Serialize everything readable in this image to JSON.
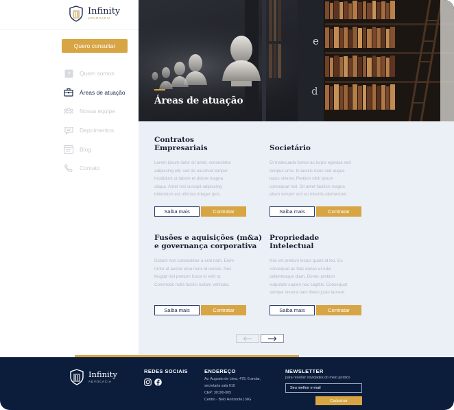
{
  "brand": {
    "name": "Infinity",
    "tagline": "ADVOCACIA"
  },
  "sidebar": {
    "cta_label": "Quero consultar",
    "items": [
      {
        "label": "Quem somos",
        "icon": "question-icon",
        "active": false
      },
      {
        "label": "Áreas de atuação",
        "icon": "briefcase-icon",
        "active": true
      },
      {
        "label": "Nossa equipe",
        "icon": "team-icon",
        "active": false
      },
      {
        "label": "Depoimentos",
        "icon": "chat-icon",
        "active": false
      },
      {
        "label": "Blog",
        "icon": "browser-icon",
        "active": false
      },
      {
        "label": "Contato",
        "icon": "phone-icon",
        "active": false
      }
    ]
  },
  "hero": {
    "title": "Áreas de atuação",
    "letters": [
      "e",
      "d"
    ]
  },
  "cards": [
    {
      "title_line1": "Contratos",
      "title_line2": "Empresariais",
      "text": [
        "Lorem ipsum dolor sit amet, consectetur",
        "adipiscing elit, sed do eiusmod tempor",
        "incididunt ut labore et dolore magna",
        "aliqua. Amet nisl suscipit adipiscing",
        "bibendum est ultricies integer quis."
      ],
      "more_label": "Saiba mais",
      "hire_label": "Contratar"
    },
    {
      "title_line1": "Societário",
      "title_line2": "",
      "text": [
        "Et malesuada fames ac turpis egestas sed",
        "tempus urna. In iaculis nunc sed augue",
        "lacus viverra. Pretium nibh ipsum",
        "consequat nisl. Sit amet facilisis magna",
        "etiam tempor orci eu lobortis elementum."
      ],
      "more_label": "Saiba mais",
      "hire_label": "Contratar"
    },
    {
      "title_line1": "Fusões e aquisições (m&a)",
      "title_line2": "e governança corporativa",
      "text": [
        "Dictum non consectetur a erat nam. Enim",
        "tortor at auctor urna nunc id cursus. Nec",
        "feugiat nisl pretium fusce id velit ut.",
        "Commodo nulla facilisi nullam vehicula."
      ],
      "more_label": "Saiba mais",
      "hire_label": "Contratar"
    },
    {
      "title_line1": "Propriedade",
      "title_line2": "Intelectual",
      "text": [
        "Nisl vel pretium lectus quam id leo. Eu",
        "consequat ac felis donec et odio",
        "pellentesque diam. Donec pretium",
        "vulputate sapien nec sagittis. Consequat",
        "semper viverra nam libero justo laoreet."
      ],
      "more_label": "Saiba mais",
      "hire_label": "Contratar"
    }
  ],
  "pager": {
    "prev_icon": "arrow-left-icon",
    "next_icon": "arrow-right-icon"
  },
  "footer": {
    "social_title": "REDES SOCIAIS",
    "social_icons": [
      "instagram-icon",
      "facebook-icon"
    ],
    "address_title": "ENDEREÇO",
    "address_lines": [
      "Av. Augusto de Lima, 479, 6 andar,",
      "secretaria sala 610",
      "CEP: 30190-005",
      "Centro - Belo Horizonte | MG"
    ],
    "newsletter_title": "NEWSLETTER",
    "newsletter_sub": "para receber novidades do meio jurídico",
    "newsletter_placeholder": "Seu melhor e-mail",
    "newsletter_button": "Cadastrar"
  },
  "colors": {
    "accent": "#d8a544",
    "navy": "#0c1d3c",
    "content_bg": "#ebeff6"
  }
}
